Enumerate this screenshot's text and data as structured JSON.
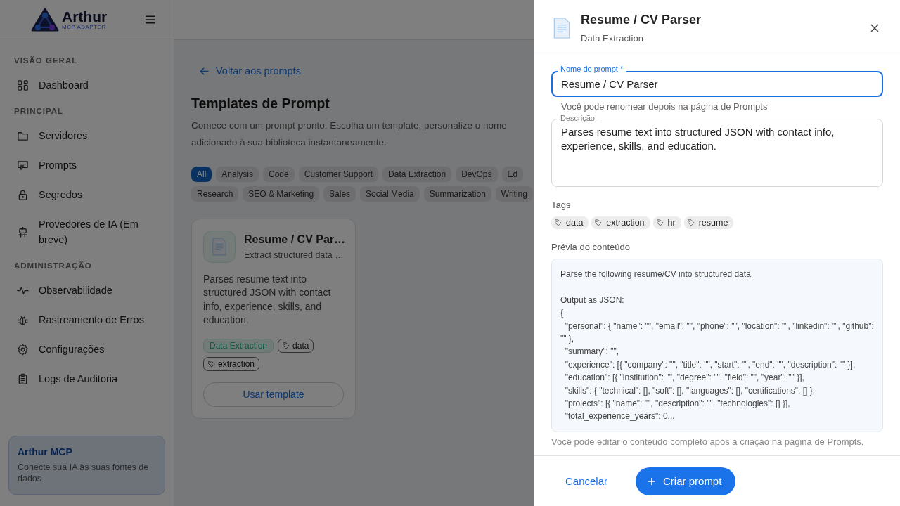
{
  "sidebar": {
    "logo": {
      "name": "Arthur",
      "tagline": "MCP ADAPTER"
    },
    "sections": [
      {
        "title": "VISÃO GERAL",
        "items": [
          {
            "label": "Dashboard"
          }
        ]
      },
      {
        "title": "PRINCIPAL",
        "items": [
          {
            "label": "Servidores"
          },
          {
            "label": "Prompts"
          },
          {
            "label": "Segredos"
          },
          {
            "label": "Provedores de IA (Em breve)"
          }
        ]
      },
      {
        "title": "ADMINISTRAÇÃO",
        "items": [
          {
            "label": "Observabilidade"
          },
          {
            "label": "Rastreamento de Erros"
          },
          {
            "label": "Configurações"
          },
          {
            "label": "Logs de Auditoria"
          }
        ]
      }
    ],
    "promo": {
      "title": "Arthur MCP",
      "text": "Conecte sua IA às suas fontes de dados"
    }
  },
  "main": {
    "back_link": "Voltar aos prompts",
    "title": "Templates de Prompt",
    "description_lines": [
      "Comece com um prompt pronto. Escolha um template, personalize o nome",
      "adicionado à sua biblioteca instantaneamente."
    ],
    "filter_rows": [
      [
        {
          "label": "All",
          "selected": true
        },
        {
          "label": "Analysis",
          "selected": false
        },
        {
          "label": "Code",
          "selected": false
        },
        {
          "label": "Customer Support",
          "selected": false
        },
        {
          "label": "Data Extraction",
          "selected": false
        },
        {
          "label": "DevOps",
          "selected": false
        },
        {
          "label": "Ed",
          "selected": false
        }
      ],
      [
        {
          "label": "Research",
          "selected": false
        },
        {
          "label": "SEO & Marketing",
          "selected": false
        },
        {
          "label": "Sales",
          "selected": false
        },
        {
          "label": "Social Media",
          "selected": false
        },
        {
          "label": "Summarization",
          "selected": false
        },
        {
          "label": "Writing",
          "selected": false
        }
      ]
    ],
    "cards": [
      {
        "title": "Resume / CV Par…",
        "subtitle": "Extract structured data …",
        "description": "Parses resume text into structured JSON with contact info, experience, skills, and education.",
        "category": "Data Extraction",
        "tags": [
          "data",
          "extraction"
        ],
        "button": "Usar template"
      }
    ]
  },
  "drawer": {
    "title": "Resume / CV Parser",
    "subtitle": "Data Extraction",
    "name_field": {
      "label": "Nome do prompt *",
      "value": "Resume / CV Parser",
      "helper": "Você pode renomear depois na página de Prompts"
    },
    "description_field": {
      "label": "Descrição",
      "value": "Parses resume text into structured JSON with contact info, experience, skills, and education."
    },
    "tags_label": "Tags",
    "tags": [
      "data",
      "extraction",
      "hr",
      "resume"
    ],
    "preview_label": "Prévia do conteúdo",
    "preview": "Parse the following resume/CV into structured data.\n\nOutput as JSON:\n{\n  \"personal\": { \"name\": \"\", \"email\": \"\", \"phone\": \"\", \"location\": \"\", \"linkedin\": \"\", \"github\": \"\" },\n  \"summary\": \"\",\n  \"experience\": [{ \"company\": \"\", \"title\": \"\", \"start\": \"\", \"end\": \"\", \"description\": \"\" }],\n  \"education\": [{ \"institution\": \"\", \"degree\": \"\", \"field\": \"\", \"year\": \"\" }],\n  \"skills\": { \"technical\": [], \"soft\": [], \"languages\": [], \"certifications\": [] },\n  \"projects\": [{ \"name\": \"\", \"description\": \"\", \"technologies\": [] }],\n  \"total_experience_years\": 0...",
    "preview_helper": "Você pode editar o conteúdo completo após a criação na página de Prompts.",
    "cancel": "Cancelar",
    "submit": "Criar prompt"
  }
}
